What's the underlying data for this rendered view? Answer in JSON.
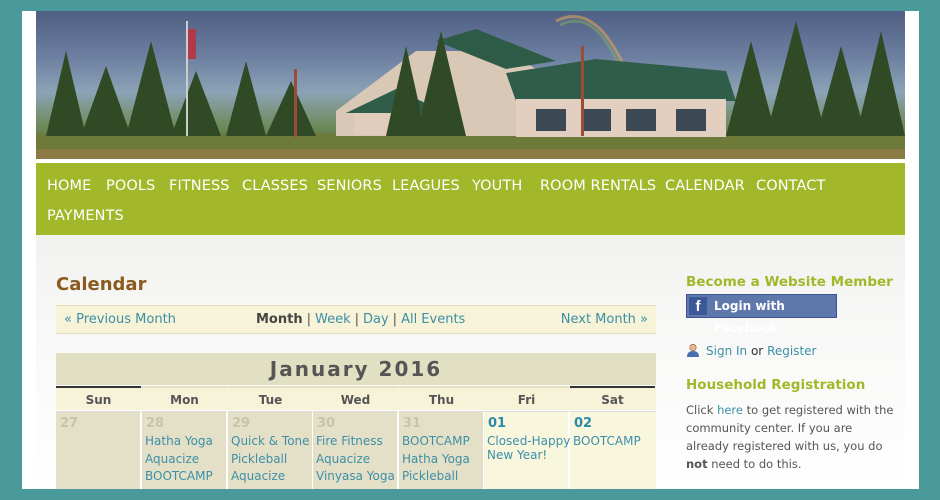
{
  "nav": {
    "items": [
      "HOME",
      "POOLS",
      "FITNESS",
      "CLASSES",
      "SENIORS",
      "LEAGUES",
      "YOUTH",
      "ROOM RENTALS",
      "CALENDAR",
      "CONTACT",
      "PAYMENTS"
    ]
  },
  "page": {
    "title": "Calendar"
  },
  "calendar_nav": {
    "prev": "« Previous Month",
    "month": "Month",
    "week": "Week",
    "day": "Day",
    "all_events": "All Events",
    "separator": "|",
    "next": "Next Month »"
  },
  "calendar": {
    "month_title": "January 2016",
    "weekdays": [
      "Sun",
      "Mon",
      "Tue",
      "Wed",
      "Thu",
      "Fri",
      "Sat"
    ],
    "days": [
      {
        "num": "27",
        "current": false,
        "events": []
      },
      {
        "num": "28",
        "current": false,
        "events": [
          "Hatha Yoga",
          "Aquacize",
          "BOOTCAMP"
        ]
      },
      {
        "num": "29",
        "current": false,
        "events": [
          "Quick & Tone",
          "Pickleball",
          "Aquacize"
        ]
      },
      {
        "num": "30",
        "current": false,
        "events": [
          "Fire Fitness",
          "Aquacize",
          "Vinyasa Yoga"
        ]
      },
      {
        "num": "31",
        "current": false,
        "events": [
          "BOOTCAMP",
          "Hatha Yoga",
          "Pickleball"
        ]
      },
      {
        "num": "01",
        "current": true,
        "events": [
          "Closed-Happy",
          "New Year!"
        ]
      },
      {
        "num": "02",
        "current": true,
        "events": [
          "BOOTCAMP"
        ]
      }
    ]
  },
  "sidebar": {
    "member_heading": "Become a Website Member",
    "facebook_button": "Login with Facebook",
    "facebook_letter": "f",
    "sign_in": "Sign In",
    "or": "or",
    "register": "Register",
    "household_heading": "Household Registration",
    "household_p1": "Click",
    "household_link": "here",
    "household_p2": "to get registered with the community center. If you are already registered with us, you do",
    "household_not": "not",
    "household_p3": "need to do this."
  },
  "colors": {
    "nav_bg": "#a2b72a",
    "accent_link": "#3d8fa6",
    "title_brown": "#8a5a1e",
    "outer_bg": "#4a9a9c"
  }
}
